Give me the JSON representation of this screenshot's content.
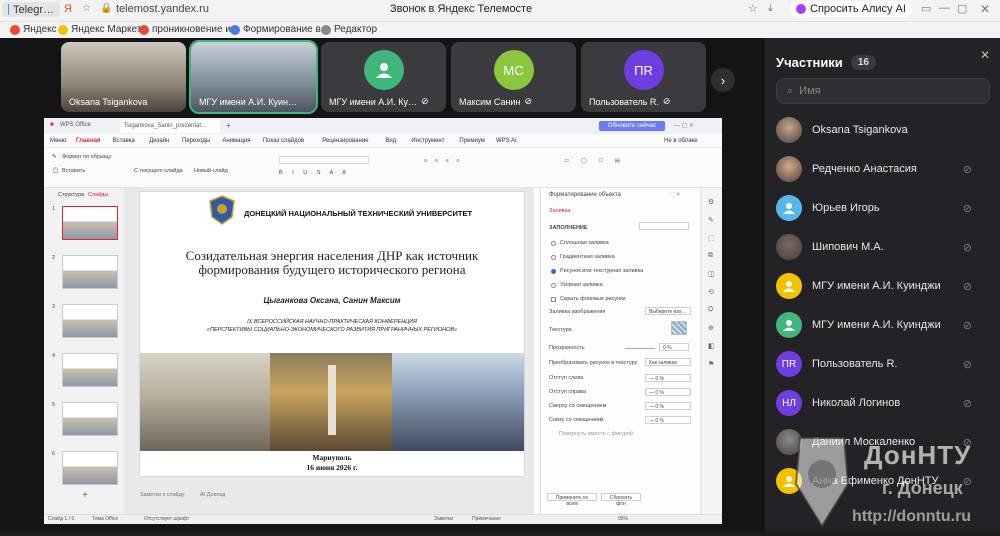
{
  "browser": {
    "tab_title": "Telegr…",
    "url": "telemost.yandex.ru",
    "page_title": "Звонок в Яндекс Телемосте",
    "alice": "Спросить Алису AI",
    "bookmarks": [
      "Яндекс",
      "Яндекс Маркет",
      "проникновение и…",
      "Формирование в…",
      "Редактор"
    ]
  },
  "tiles": [
    {
      "name": "Oksana Tsigankova",
      "initials": "",
      "color": "#57534f",
      "muted": false,
      "video": true
    },
    {
      "name": "МГУ имени А.И. Куин…",
      "initials": "",
      "color": "#5f6a75",
      "muted": false,
      "video": true,
      "active": true
    },
    {
      "name": "МГУ имени А.И. Ку…",
      "initials": "",
      "color": "#3fb77a",
      "muted": true,
      "video": false,
      "icon": "user-icon"
    },
    {
      "name": "Максим Санин",
      "initials": "МС",
      "color": "#8cc63f",
      "muted": true,
      "video": false
    },
    {
      "name": "Пользователь R.",
      "initials": "ПR",
      "color": "#6f3ee0",
      "muted": true,
      "video": false
    }
  ],
  "wps": {
    "app": "WPS Office",
    "doc_tab": "Tsigankova_Sanin_prezentat…",
    "signin": "Обновите сейчас",
    "menu_tabs": [
      "Меню",
      "Главная",
      "Вставка",
      "Дизайн",
      "Переходы",
      "Анимация",
      "Показ слайдов",
      "Рецензирование",
      "Вид",
      "Инструмент",
      "Премиум",
      "WPS AI"
    ],
    "cloud": "Не в облаке",
    "ribbon": [
      "Формат по образцу",
      "Вставить",
      "С текущего слайда",
      "Новый слайд"
    ],
    "left_tabs": [
      "Структура",
      "Слайды"
    ],
    "slide_numbers": [
      "1",
      "2",
      "3",
      "4",
      "5",
      "6"
    ],
    "notes": "Заметки к слайду",
    "ai_report": "AI Доклад",
    "status": [
      "Слайд 1 / 9",
      "Тема Office",
      "Отсутствует шрифт",
      "Заметки",
      "Примечание",
      "95%"
    ]
  },
  "slide": {
    "university": "ДОНЕЦКИЙ НАЦИОНАЛЬНЫЙ ТЕХНИЧЕСКИЙ УНИВЕРСИТЕТ",
    "title": "Созидательная энергия населения ДНР как источник формирования будущего исторического региона",
    "authors": "Цыганкова Оксана, Санин Максим",
    "conf_line1": "IX ВСЕРОССИЙСКАЯ НАУЧНО-ПРАКТИЧЕСКАЯ КОНФЕРЕНЦИЯ",
    "conf_line2": "«ПЕРСПЕКТИВЫ СОЦИАЛЬНО-ЭКОНОМИЧЕСКОГО РАЗВИТИЯ ПРИГРАНИЧНЫХ РЕГИОНОВ»",
    "city": "Мариуполь",
    "date": "16 июня 2026 г."
  },
  "format_pane": {
    "title": "Форматирование объекта",
    "tab": "Заливка",
    "section": "ЗАПОЛНЕНИЕ",
    "options": [
      "Сплошная заливка",
      "Градиентная заливка",
      "Рисунок или текстурная заливка",
      "Узорная заливка",
      "Скрыть фоновые рисунки"
    ],
    "selected_option": "Рисунок или текстурная заливка",
    "image_fill_label": "Заливка изображения",
    "image_fill_value": "Выберите изо…",
    "texture_label": "Текстура",
    "transparency_label": "Прозрачность",
    "transparency_value": "0",
    "convert_label": "Преобразовать рисунок в текстуру",
    "convert_value": "Как заливка",
    "offsets": [
      {
        "label": "Отступ слева",
        "value": "0"
      },
      {
        "label": "Отступ справа",
        "value": "0"
      },
      {
        "label": "Сверху со смещением",
        "value": "0"
      },
      {
        "label": "Снизу со смещением",
        "value": "0"
      }
    ],
    "rotate": "Повернуть вместе с фигурой",
    "apply_all": "Применить ко всем",
    "reset": "Сбросить фон"
  },
  "sidebar": {
    "title": "Участники",
    "count": "16",
    "search_placeholder": "Имя",
    "participants": [
      {
        "name": "Oksana Tsigankova",
        "initials": "",
        "color": "#c9a58f",
        "muted": false,
        "photo": true
      },
      {
        "name": "Редченко Анастасия",
        "initials": "",
        "color": "#d6a98a",
        "muted": true,
        "photo": true
      },
      {
        "name": "Юрьев Игорь",
        "initials": "",
        "color": "#56b8e6",
        "muted": true,
        "photo": false
      },
      {
        "name": "Шипович М.А.",
        "initials": "",
        "color": "#7a6a60",
        "muted": true,
        "photo": true
      },
      {
        "name": "МГУ имени А.И. Куинджи",
        "initials": "",
        "color": "#f2c200",
        "muted": true,
        "photo": false
      },
      {
        "name": "МГУ имени А.И. Куинджи",
        "initials": "",
        "color": "#3fb77a",
        "muted": true,
        "photo": false
      },
      {
        "name": "Пользователь R.",
        "initials": "ПR",
        "color": "#6f3ee0",
        "muted": true,
        "photo": false
      },
      {
        "name": "Николай Логинов",
        "initials": "НЛ",
        "color": "#6f3ee0",
        "muted": true,
        "photo": false
      },
      {
        "name": "Даниил Москаленко",
        "initials": "",
        "color": "#8b8b8b",
        "muted": true,
        "photo": true
      },
      {
        "name": "Анна Ефименко ДонНТУ",
        "initials": "",
        "color": "#f2c200",
        "muted": true,
        "photo": false
      }
    ]
  },
  "watermark": {
    "line1": "ДонНТУ",
    "line2": "г. Донецк",
    "url": "http://donntu.ru"
  }
}
